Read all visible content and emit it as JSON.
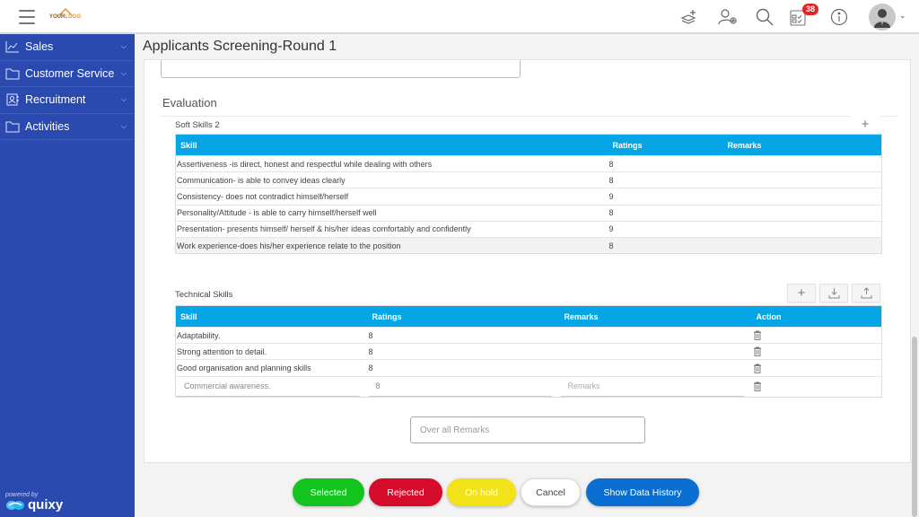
{
  "header": {
    "logo_text_a": "YOUR",
    "logo_text_b": "LOGO",
    "notification_count": "38",
    "icons": [
      "layers-add-icon",
      "user-settings-icon",
      "search-icon",
      "tasks-icon",
      "info-icon",
      "avatar"
    ]
  },
  "sidebar": {
    "items": [
      {
        "label": "Sales",
        "icon": "chart-icon"
      },
      {
        "label": "Customer Service",
        "icon": "folder-icon"
      },
      {
        "label": "Recruitment",
        "icon": "contact-card-icon"
      },
      {
        "label": "Activities",
        "icon": "folder-icon"
      }
    ],
    "powered_by": "powered by",
    "brand": "quixy"
  },
  "page": {
    "title": "Applicants Screening-Round 1",
    "evaluation_label": "Evaluation"
  },
  "soft_skills": {
    "title": "Soft Skills 2",
    "columns": [
      "Skill",
      "Ratings",
      "Remarks"
    ],
    "rows": [
      {
        "skill": "Assertiveness -is direct, honest and respectful while dealing with others",
        "rating": "8",
        "remarks": ""
      },
      {
        "skill": "Communication- is able to convey ideas clearly",
        "rating": "8",
        "remarks": ""
      },
      {
        "skill": "Consistency- does not contradict himself/herself",
        "rating": "9",
        "remarks": ""
      },
      {
        "skill": "Personality/Attitude - is able to carry himself/herself well",
        "rating": "8",
        "remarks": ""
      },
      {
        "skill": "Presentation- presents himself/ herself & his/her ideas comfortably and confidently",
        "rating": "9",
        "remarks": ""
      },
      {
        "skill": "Work experience-does his/her experience relate to the position",
        "rating": "8",
        "remarks": ""
      }
    ]
  },
  "technical_skills": {
    "title": "Technical Skills",
    "columns": [
      "Skill",
      "Ratings",
      "Remarks",
      "Action"
    ],
    "rows": [
      {
        "skill": "Adaptability.",
        "rating": "8",
        "remarks": ""
      },
      {
        "skill": "Strong attention to detail.",
        "rating": "8",
        "remarks": ""
      },
      {
        "skill": "Good organisation and planning skills",
        "rating": "8",
        "remarks": ""
      }
    ],
    "edit_row": {
      "skill_value": "Commercial awareness.",
      "rating_value": "8",
      "remarks_placeholder": "Remarks"
    }
  },
  "overall_remarks": {
    "placeholder": "Over all Remarks",
    "value": ""
  },
  "actions": {
    "selected": "Selected",
    "rejected": "Rejected",
    "on_hold": "On hold",
    "cancel": "Cancel",
    "show_history": "Show Data History"
  },
  "colors": {
    "sidebar": "#2a4aaf",
    "table_header": "#06a6e6",
    "selected": "#13c41f",
    "rejected": "#d40b2a",
    "on_hold": "#f2e21a",
    "history": "#0a6fd0",
    "badge": "#e32228"
  }
}
